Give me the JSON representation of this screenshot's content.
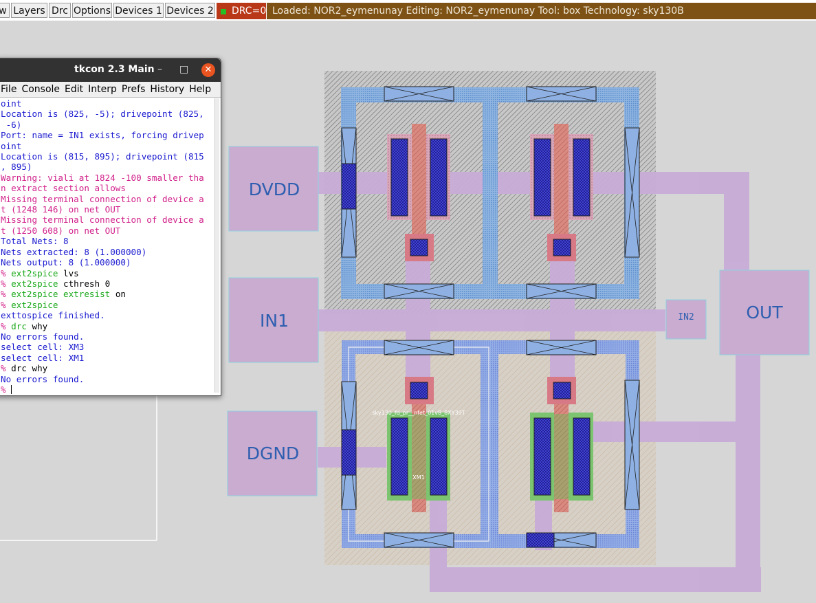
{
  "menu": {
    "buttons": [
      "w",
      "Layers",
      "Drc",
      "Options",
      "Devices 1",
      "Devices 2"
    ],
    "drc_label": "DRC=0",
    "status": "Loaded: NOR2_eymenunay Editing: NOR2_eymenunay Tool: box  Technology: sky130B"
  },
  "layout": {
    "labels": {
      "dvdd": "DVDD",
      "in1": "IN1",
      "dgnd": "DGND",
      "in2": "IN2",
      "out": "OUT",
      "device_name": "sky130_fd_pr__nfet_01v8_8XY39T",
      "instance": "XM1"
    }
  },
  "tkcon": {
    "title": "tkcon 2.3 Main",
    "menu": [
      "File",
      "Console",
      "Edit",
      "Interp",
      "Prefs",
      "History",
      "Help"
    ],
    "lines": [
      {
        "text": "oint",
        "color": "blue"
      },
      {
        "text": "Location is (825, -5); drivepoint (825,",
        "color": "blue"
      },
      {
        "text": " -6)",
        "color": "blue"
      },
      {
        "text": "Port: name = IN1 exists, forcing drivep",
        "color": "blue"
      },
      {
        "text": "oint",
        "color": "blue"
      },
      {
        "text": "Location is (815, 895); drivepoint (815",
        "color": "blue"
      },
      {
        "text": ", 895)",
        "color": "blue"
      },
      {
        "text": "Warning: viali at 1824 -100 smaller tha",
        "color": "magenta"
      },
      {
        "text": "n extract section allows",
        "color": "magenta"
      },
      {
        "text": "Missing terminal connection of device a",
        "color": "magenta"
      },
      {
        "text": "t (1248 146) on net OUT",
        "color": "magenta"
      },
      {
        "text": "Missing terminal connection of device a",
        "color": "magenta"
      },
      {
        "text": "t (1250 608) on net OUT",
        "color": "magenta"
      },
      {
        "text": "Total Nets: 8",
        "color": "blue"
      },
      {
        "text": "Nets extracted: 8 (1.000000)",
        "color": "blue"
      },
      {
        "text": "Nets output: 8 (1.000000)",
        "color": "blue"
      },
      {
        "prompt": "% ",
        "cmd": "ext2spice",
        "arg": " lvs"
      },
      {
        "prompt": "% ",
        "cmd": "ext2spice",
        "arg": " cthresh 0"
      },
      {
        "prompt": "% ",
        "cmd": "ext2spice extresist",
        "arg": " on"
      },
      {
        "prompt": "% ",
        "cmd": "ext2spice",
        "arg": ""
      },
      {
        "text": "exttospice finished.",
        "color": "blue"
      },
      {
        "prompt": "% ",
        "cmd": "drc",
        "arg": " why"
      },
      {
        "text": "No errors found.",
        "color": "blue"
      },
      {
        "text": "select cell: XM3",
        "color": "blue"
      },
      {
        "text": "select cell: XM1",
        "color": "blue"
      },
      {
        "prompt": "% ",
        "cmd": "",
        "arg": "drc why"
      },
      {
        "text": "No errors found.",
        "color": "blue"
      },
      {
        "prompt": "% ",
        "cmd": "",
        "arg": "",
        "cursor": true
      }
    ]
  }
}
